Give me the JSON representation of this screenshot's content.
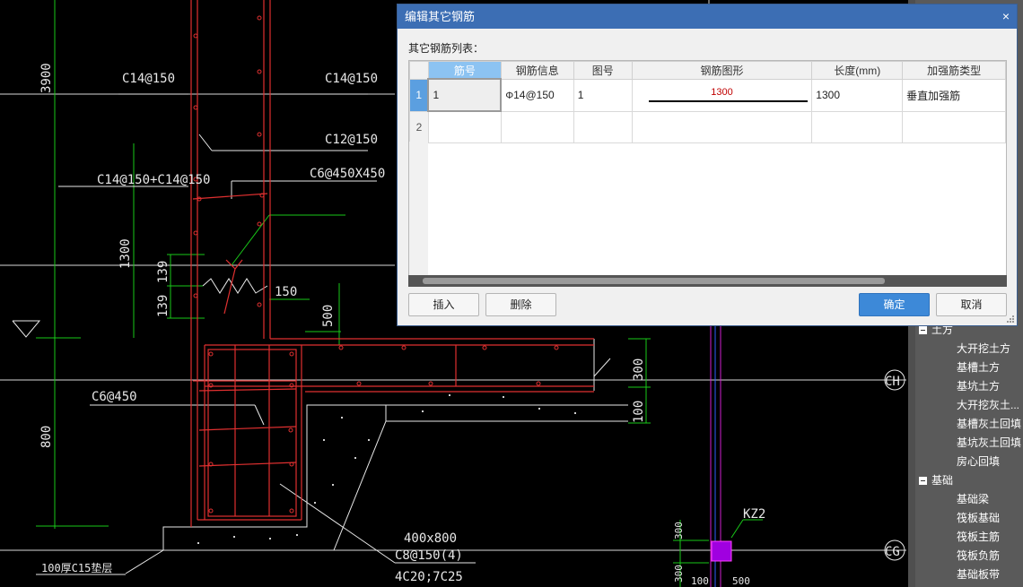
{
  "drawing": {
    "labels": [
      {
        "key": "c14_a",
        "text": "C14@150"
      },
      {
        "key": "c14_b",
        "text": "C14@150"
      },
      {
        "key": "c12",
        "text": "C12@150"
      },
      {
        "key": "c14c14",
        "text": "C14@150+C14@150"
      },
      {
        "key": "c6x",
        "text": "C6@450X450"
      },
      {
        "key": "d150",
        "text": "150"
      },
      {
        "key": "d500",
        "text": "500"
      },
      {
        "key": "d300",
        "text": "300"
      },
      {
        "key": "d100",
        "text": "100"
      },
      {
        "key": "c6",
        "text": "C6@450"
      },
      {
        "key": "d800",
        "text": "800"
      },
      {
        "key": "d1300",
        "text": "1300"
      },
      {
        "key": "d139a",
        "text": "139"
      },
      {
        "key": "d139b",
        "text": "139"
      },
      {
        "key": "d3900",
        "text": "3900"
      },
      {
        "key": "beam",
        "text": "400x800"
      },
      {
        "key": "stir",
        "text": "C8@150(4)"
      },
      {
        "key": "bars",
        "text": "4C20;7C25"
      },
      {
        "key": "pad",
        "text": "100厚C15垫层"
      },
      {
        "key": "kz",
        "text": "KZ2"
      },
      {
        "key": "axis_ch",
        "text": "CH"
      },
      {
        "key": "axis_cg",
        "text": "CG"
      },
      {
        "key": "d300b",
        "text": "300"
      },
      {
        "key": "d300c",
        "text": "300"
      },
      {
        "key": "d100b",
        "text": "100"
      },
      {
        "key": "d500b",
        "text": "500"
      }
    ]
  },
  "tree": {
    "items": [
      {
        "type": "group",
        "label": "土方"
      },
      {
        "type": "leaf",
        "label": "大开挖土方"
      },
      {
        "type": "leaf",
        "label": "基槽土方"
      },
      {
        "type": "leaf",
        "label": "基坑土方"
      },
      {
        "type": "leaf",
        "label": "大开挖灰土..."
      },
      {
        "type": "leaf",
        "label": "基槽灰土回填"
      },
      {
        "type": "leaf",
        "label": "基坑灰土回填"
      },
      {
        "type": "leaf",
        "label": "房心回填"
      },
      {
        "type": "group",
        "label": "基础"
      },
      {
        "type": "leaf",
        "label": "基础梁"
      },
      {
        "type": "leaf",
        "label": "筏板基础"
      },
      {
        "type": "leaf",
        "label": "筏板主筋"
      },
      {
        "type": "leaf",
        "label": "筏板负筋"
      },
      {
        "type": "leaf",
        "label": "基础板带"
      }
    ]
  },
  "dialog": {
    "title": "编辑其它钢筋",
    "close": "×",
    "list_label": "其它钢筋列表：",
    "columns": [
      "筋号",
      "钢筋信息",
      "图号",
      "钢筋图形",
      "长度(mm)",
      "加强筋类型"
    ],
    "rows": [
      {
        "num": "1",
        "bar_no": "1",
        "bar_info": "14@150",
        "bar_symbol": "Φ",
        "fig_no": "1",
        "shape_value": "1300",
        "length": "1300",
        "type": "垂直加强筋"
      },
      {
        "num": "2",
        "bar_no": "",
        "bar_info": "",
        "bar_symbol": "",
        "fig_no": "",
        "shape_value": "",
        "length": "",
        "type": ""
      }
    ],
    "buttons": {
      "insert": "插入",
      "delete": "删除",
      "ok": "确定",
      "cancel": "取消"
    }
  }
}
